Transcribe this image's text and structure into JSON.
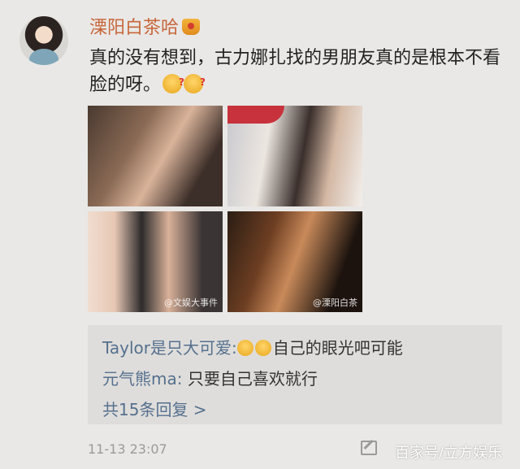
{
  "post": {
    "username": "溧阳白茶哈",
    "text": "真的没有想到，古力娜扎找的男朋友真的是根本不看脸的呀。",
    "timestamp": "11-13 23:07"
  },
  "photos": {
    "watermark_3": "@文娱大事件",
    "watermark_4": "@溧阳白茶"
  },
  "replies": [
    {
      "name": "Taylor是只大可爱:",
      "text": "自己的眼光吧可能"
    },
    {
      "name": "元气熊ma:",
      "text": "只要自己喜欢就行"
    }
  ],
  "more_replies": "共15条回复 >",
  "watermark": "百家号/立方娱乐",
  "icons": [
    "crown-icon",
    "confused-emoji-icon",
    "laugh-emoji-icon",
    "edit-icon"
  ]
}
